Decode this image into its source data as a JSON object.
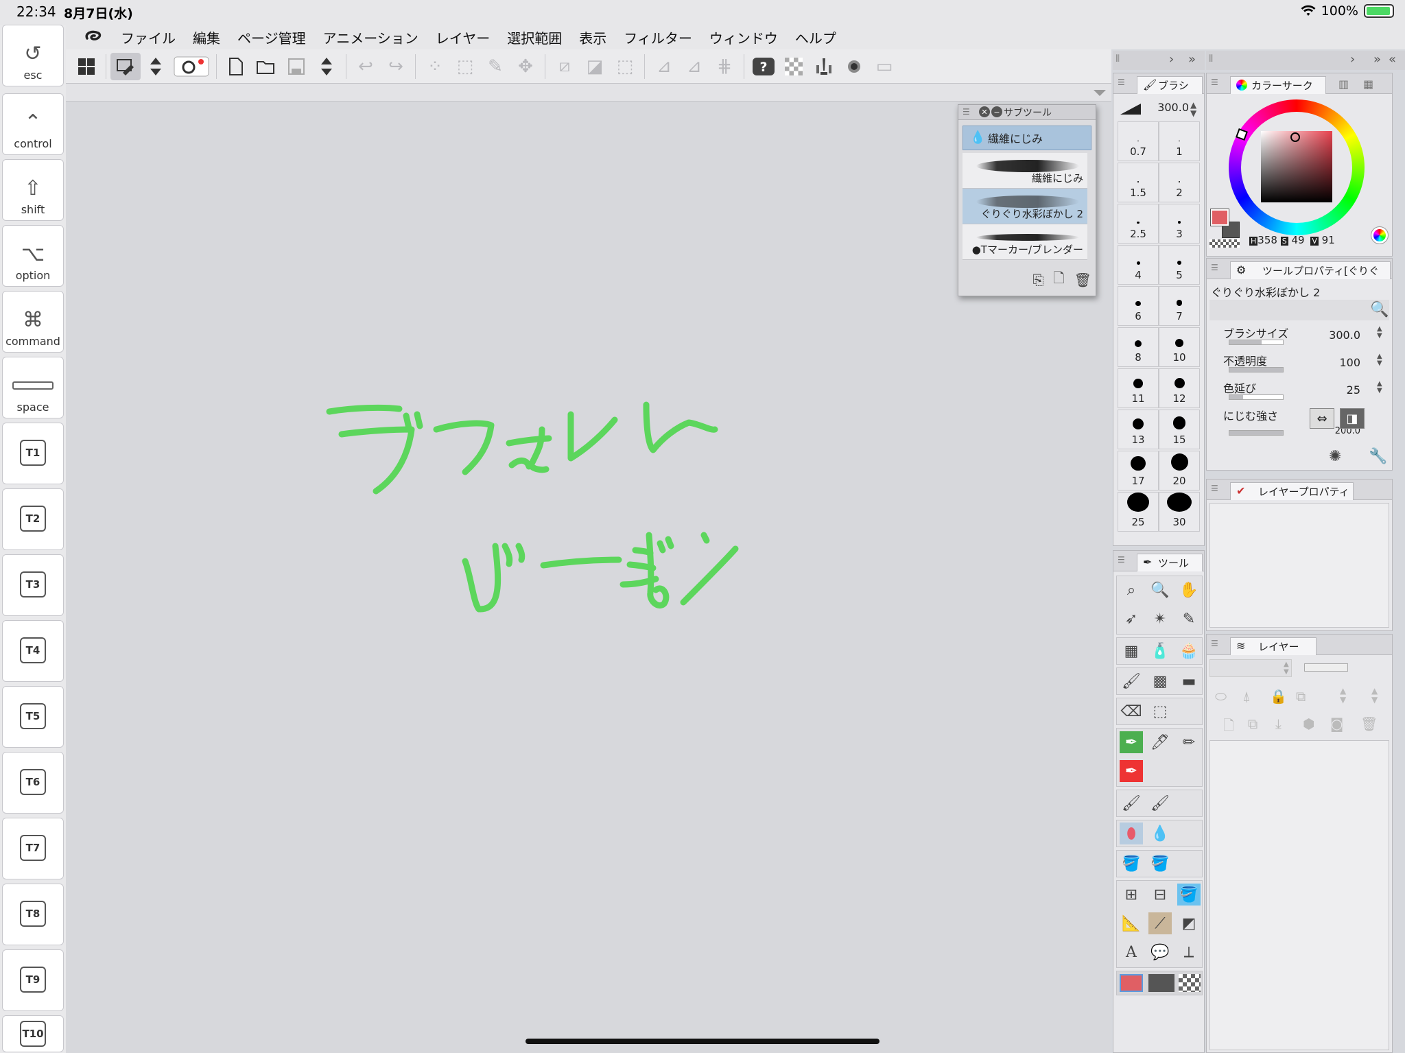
{
  "status_bar": {
    "time": "22:34",
    "date": "8月7日(水)",
    "battery_percent": "100%",
    "battery_level": 1.0
  },
  "modifier_keys": [
    {
      "label": "esc",
      "icon": "undo-arrow-icon"
    },
    {
      "label": "control",
      "icon": "control-caret-icon"
    },
    {
      "label": "shift",
      "icon": "shift-arrow-icon"
    },
    {
      "label": "option",
      "icon": "option-key-icon"
    },
    {
      "label": "command",
      "icon": "command-key-icon"
    },
    {
      "label": "space",
      "icon": "space-bar-icon"
    }
  ],
  "t_keys": [
    "T1",
    "T2",
    "T3",
    "T4",
    "T5",
    "T6",
    "T7",
    "T8",
    "T9",
    "T10"
  ],
  "menu": [
    "ファイル",
    "編集",
    "ページ管理",
    "アニメーション",
    "レイヤー",
    "選択範囲",
    "表示",
    "フィルター",
    "ウィンドウ",
    "ヘルプ"
  ],
  "canvas": {
    "stroke_color": "#5cd65c",
    "line1": "デフォルト",
    "line2": "バージョン"
  },
  "subtool_panel": {
    "title": "サブツール",
    "selected_group": "繊維にじみ",
    "items": [
      "繊維にじみ",
      "ぐりぐり水彩ぼかし 2",
      "●Tマーカー/ブレンダー"
    ],
    "selected_item": "ぐりぐり水彩ぼかし 2"
  },
  "brush_size_panel": {
    "tab": "ブラシ",
    "value": "300.0",
    "sizes": [
      "0.7",
      "1",
      "1.5",
      "2",
      "2.5",
      "3",
      "4",
      "5",
      "6",
      "7",
      "8",
      "10",
      "11",
      "12",
      "13",
      "15",
      "17",
      "20",
      "25",
      "30"
    ]
  },
  "tool_panel": {
    "tab": "ツール"
  },
  "color_panel": {
    "tab": "カラーサーク",
    "h_label": "H",
    "h_value": "358",
    "s_label": "S",
    "s_value": "49",
    "v_label": "V",
    "v_value": "91",
    "main_color": "#e05f64",
    "sub_color": "#555555"
  },
  "tool_property_panel": {
    "tab": "ツールプロパティ[ぐりぐ",
    "tool_name": "ぐりぐり水彩ぼかし 2",
    "props": [
      {
        "label": "ブラシサイズ",
        "value": "300.0",
        "fill": 0.6
      },
      {
        "label": "不透明度",
        "value": "100",
        "fill": 1.0
      },
      {
        "label": "色延び",
        "value": "25",
        "fill": 0.25
      },
      {
        "label": "にじむ強さ",
        "value": "200.0",
        "fill": 1.0
      }
    ]
  },
  "layer_property_panel": {
    "tab": "レイヤープロパティ"
  },
  "layer_panel": {
    "tab": "レイヤー"
  }
}
